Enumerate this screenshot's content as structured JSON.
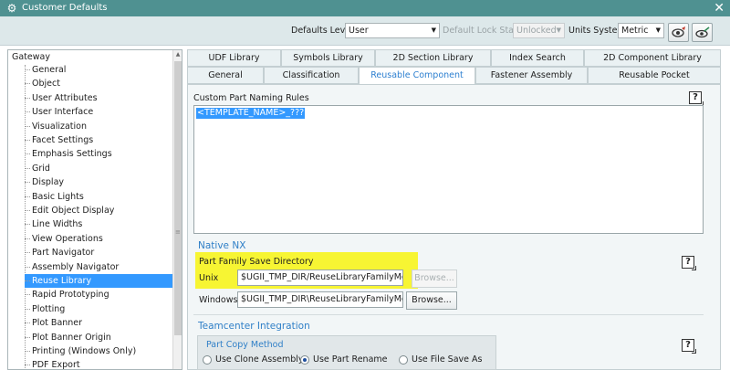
{
  "window": {
    "title": "Customer Defaults",
    "close_glyph": "✕"
  },
  "topbar": {
    "defaults_level_label": "Defaults Level",
    "defaults_level_value": "User",
    "default_lock_state_label": "Default Lock State",
    "default_lock_state_value": "Unlocked",
    "units_system_label": "Units System",
    "units_system_value": "Metric"
  },
  "tree": {
    "root": "Gateway",
    "items": [
      "General",
      "Object",
      "User Attributes",
      "User Interface",
      "Visualization",
      "Facet Settings",
      "Emphasis Settings",
      "Grid",
      "Display",
      "Basic Lights",
      "Edit Object Display",
      "Line Widths",
      "View Operations",
      "Part Navigator",
      "Assembly Navigator",
      "Reuse Library",
      "Rapid Prototyping",
      "Plotting",
      "Plot Banner",
      "Plot Banner Origin",
      "Printing (Windows Only)",
      "PDF Export"
    ],
    "selected_index": 15
  },
  "tabs": {
    "row1": [
      "UDF Library",
      "Symbols Library",
      "2D Section Library",
      "Index Search",
      "2D Component Library"
    ],
    "row2": [
      "General",
      "Classification",
      "Reusable Component",
      "Fastener Assembly",
      "Reusable Pocket"
    ],
    "active": "Reusable Component"
  },
  "content": {
    "custom_naming_label": "Custom Part Naming Rules",
    "custom_naming_value": "<TEMPLATE_NAME>_???",
    "native_nx_header": "Native NX",
    "part_family_label": "Part Family Save Directory",
    "unix_label": "Unix",
    "unix_value": "$UGII_TMP_DIR/ReuseLibraryFamilyMembers",
    "windows_label": "Windows",
    "windows_value": "$UGII_TMP_DIR\\ReuseLibraryFamilyMembers",
    "browse_label": "Browse...",
    "teamcenter_header": "Teamcenter Integration",
    "part_copy_label": "Part Copy Method",
    "options": [
      "Use Clone Assembly",
      "Use Part Rename",
      "Use File Save As"
    ],
    "selected_option": "Use Part Rename"
  },
  "help_glyph": "?",
  "icons": {
    "window": "gear-icon",
    "view_filter": "eye-filter-icon",
    "lock_pointer": "eye-lock-icon"
  },
  "colors": {
    "titlebar": "#4f9191",
    "selection": "#3399ff",
    "highlight": "#f7f533",
    "group_header": "#2f7fc7"
  }
}
